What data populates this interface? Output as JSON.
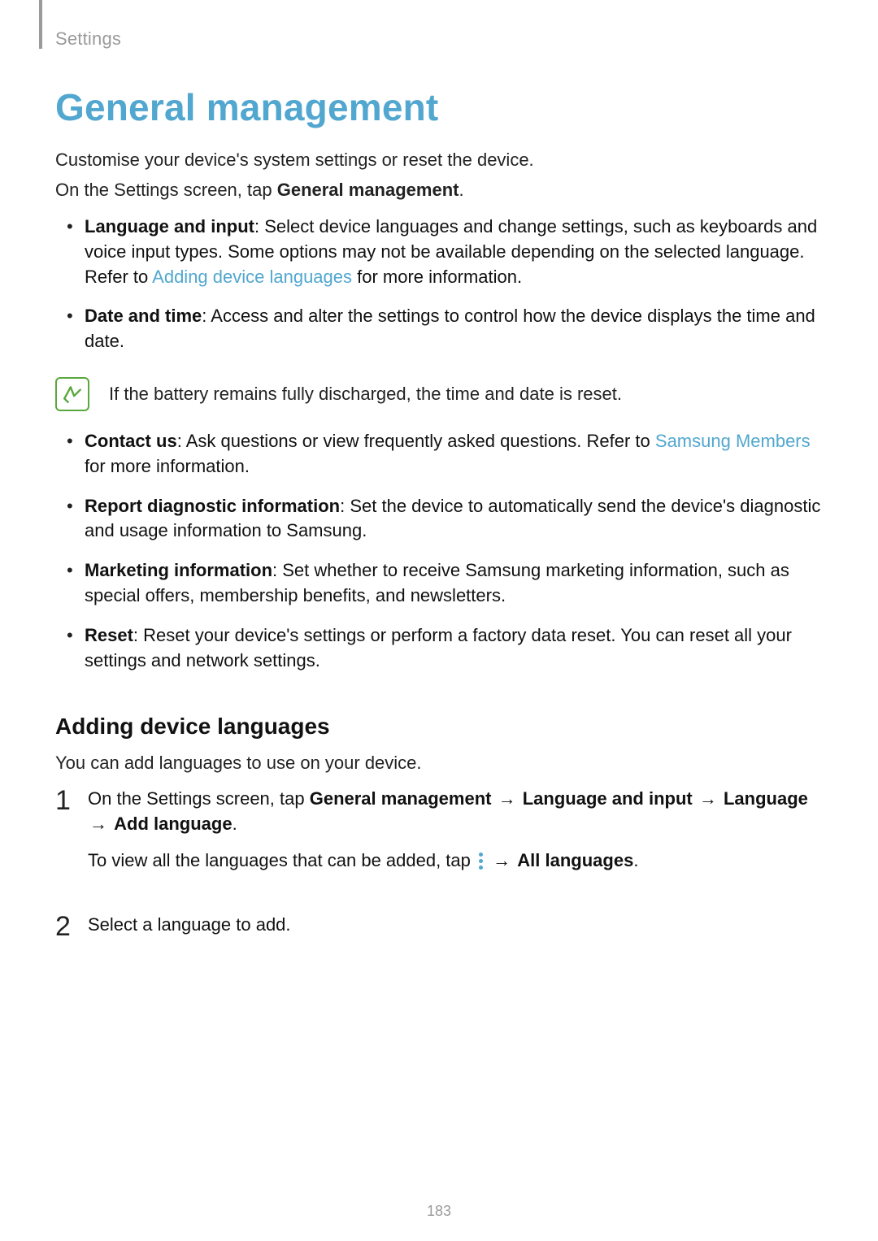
{
  "breadcrumb": "Settings",
  "title": "General management",
  "lead1": "Customise your device's system settings or reset the device.",
  "lead2_a": "On the Settings screen, tap ",
  "lead2_b": "General management",
  "lead2_c": ".",
  "bullets1": [
    {
      "label": "Language and input",
      "desc_a": ": Select device languages and change settings, such as keyboards and voice input types. Some options may not be available depending on the selected language. Refer to ",
      "link": "Adding device languages",
      "desc_b": " for more information."
    },
    {
      "label": "Date and time",
      "desc_a": ": Access and alter the settings to control how the device displays the time and date.",
      "link": "",
      "desc_b": ""
    }
  ],
  "note_text": "If the battery remains fully discharged, the time and date is reset.",
  "bullets2": [
    {
      "label": "Contact us",
      "desc_a": ": Ask questions or view frequently asked questions. Refer to ",
      "link": "Samsung Members",
      "desc_b": " for more information."
    },
    {
      "label": "Report diagnostic information",
      "desc_a": ": Set the device to automatically send the device's diagnostic and usage information to Samsung.",
      "link": "",
      "desc_b": ""
    },
    {
      "label": "Marketing information",
      "desc_a": ": Set whether to receive Samsung marketing information, such as special offers, membership benefits, and newsletters.",
      "link": "",
      "desc_b": ""
    },
    {
      "label": "Reset",
      "desc_a": ": Reset your device's settings or perform a factory data reset. You can reset all your settings and network settings.",
      "link": "",
      "desc_b": ""
    }
  ],
  "subheading": "Adding device languages",
  "sub_lead": "You can add languages to use on your device.",
  "steps": {
    "s1": {
      "line1_a": "On the Settings screen, tap ",
      "path1": "General management",
      "path2": "Language and input",
      "path3": "Language",
      "path4": "Add language",
      "line1_b": ".",
      "line2_a": "To view all the languages that can be added, tap ",
      "line2_b": "All languages",
      "line2_c": "."
    },
    "s2": "Select a language to add."
  },
  "arrow": "→",
  "page_number": "183"
}
